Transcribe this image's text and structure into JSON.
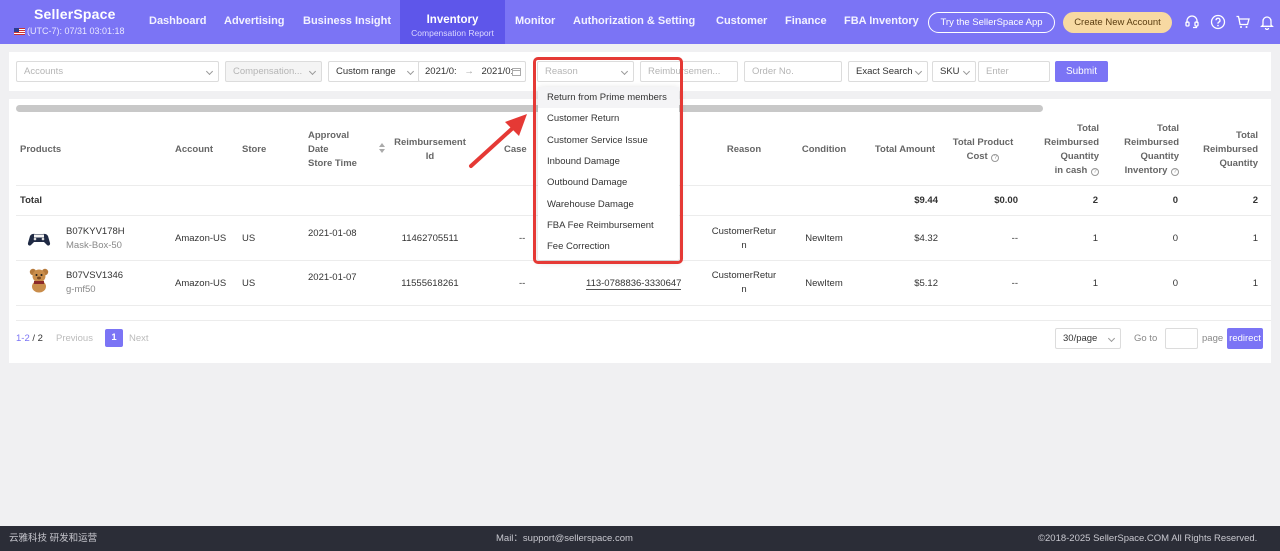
{
  "brand": {
    "name": "SellerSpace",
    "time": "(UTC-7): 07/31 03:01:18"
  },
  "nav": {
    "items": [
      "Dashboard",
      "Advertising",
      "Business Insight",
      "Monitor",
      "Authorization & Setting",
      "Customer",
      "Finance",
      "FBA Inventory"
    ],
    "active": {
      "label": "Inventory",
      "sub": "Compensation Report"
    },
    "try_app": "Try the SellerSpace App",
    "create_account": "Create New Account"
  },
  "filters": {
    "accounts_placeholder": "Accounts",
    "compensation_placeholder": "Compensation...",
    "date_range_type": "Custom range",
    "date_start": "2021/0:",
    "date_sep": "→",
    "date_end": "2021/0:",
    "reason_placeholder": "Reason",
    "reimbursement_placeholder": "Reimbursemen...",
    "order_placeholder": "Order No.",
    "search_mode": "Exact Search",
    "search_field": "SKU",
    "search_placeholder": "Enter",
    "submit": "Submit"
  },
  "table": {
    "headers": {
      "products": "Products",
      "account": "Account",
      "store": "Store",
      "approval": [
        "Approval",
        "Date",
        "Store Time"
      ],
      "reimbursement": [
        "Reimbursement",
        "Id"
      ],
      "case": "Case",
      "reason": "Reason",
      "condition": "Condition",
      "total_amount": "Total Amount",
      "total_product_cost": [
        "Total Product",
        "Cost"
      ],
      "total_reimbursed_cash": [
        "Total",
        "Reimbursed",
        "Quantity",
        "in cash"
      ],
      "total_reimbursed_inventory": [
        "Total",
        "Reimbursed",
        "Quantity",
        "Inventory"
      ],
      "total_reimbursed_quantity": [
        "Total",
        "Reimbursed",
        "Quantity"
      ]
    },
    "total_row": {
      "label": "Total",
      "total_amount": "$9.44",
      "total_product_cost": "$0.00",
      "cash_qty": "2",
      "inventory_qty": "0",
      "quantity": "2"
    },
    "rows": [
      {
        "asin": "B07KYV178H",
        "sku": "Mask-Box-50",
        "account": "Amazon-US",
        "store": "US",
        "approval_date": "2021-01-08",
        "reimbursement_id": "11462705511",
        "case": "--",
        "order": "",
        "reason": [
          "CustomerRetur",
          "n"
        ],
        "condition": "NewItem",
        "total_amount": "$4.32",
        "total_product_cost": "--",
        "cash_qty": "1",
        "inventory_qty": "0",
        "quantity": "1"
      },
      {
        "asin": "B07VSV1346",
        "sku": "g-mf50",
        "account": "Amazon-US",
        "store": "US",
        "approval_date": "2021-01-07",
        "reimbursement_id": "11555618261",
        "case": "--",
        "order": "113-0788836-3330647",
        "reason": [
          "CustomerRetur",
          "n"
        ],
        "condition": "NewItem",
        "total_amount": "$5.12",
        "total_product_cost": "--",
        "cash_qty": "1",
        "inventory_qty": "0",
        "quantity": "1"
      }
    ]
  },
  "pagination": {
    "current": "1-2",
    "sep": " / ",
    "total": "2",
    "previous": "Previous",
    "page": "1",
    "next": "Next",
    "page_size": "30/page",
    "goto": "Go to",
    "page_label": "page",
    "redirect": "redirect"
  },
  "reason_dropdown": {
    "options": [
      "Return from Prime members",
      "Customer Return",
      "Customer Service Issue",
      "Inbound Damage",
      "Outbound Damage",
      "Warehouse Damage",
      "FBA Fee Reimbursement",
      "Fee Correction"
    ]
  },
  "footer": {
    "left": "云雅科技 研发和运营",
    "mail": "Mail：support@sellerspace.com",
    "copyright": "©2018-2025 SellerSpace.COM All Rights Reserved."
  },
  "colors": {
    "primary": "#7b74f5",
    "annotation": "#e53935",
    "footer": "#2b2d37"
  }
}
